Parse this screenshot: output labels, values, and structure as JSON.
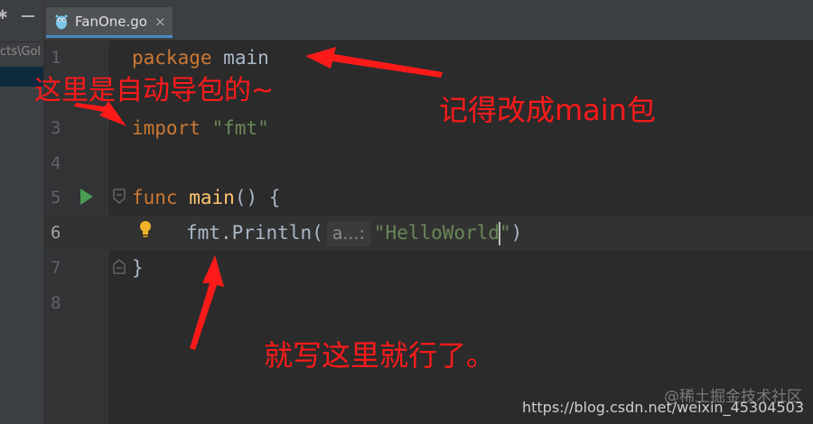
{
  "project_panel": {
    "path_fragment": "cts\\Gol"
  },
  "tab": {
    "icon": "go-gopher-icon",
    "label": "FanOne.go",
    "close_label": "×"
  },
  "editor": {
    "line_numbers": [
      "1",
      "3",
      "4",
      "5",
      "6",
      "7",
      "8"
    ],
    "lines": {
      "l1_keyword": "package",
      "l1_name": "main",
      "l3_keyword": "import",
      "l3_string": "\"fmt\"",
      "l5_keyword": "func",
      "l5_name": "main",
      "l5_rest": "() {",
      "l6_pkg": "fmt",
      "l6_call": ".Println(",
      "l6_hint": "a...:",
      "l6_string_a": "\"HelloWorld",
      "l6_string_b": "\"",
      "l6_close": ")",
      "l7_close": "}"
    }
  },
  "annotations": {
    "auto_import": "这里是自动导包的~",
    "change_main": "记得改成main包",
    "write_here": "就写这里就行了。",
    "color": "#ff1a1a"
  },
  "watermark": {
    "logo_text": "@稀土掘金技术社区",
    "url_text": "https://blog.csdn.net/weixin_45304503"
  }
}
